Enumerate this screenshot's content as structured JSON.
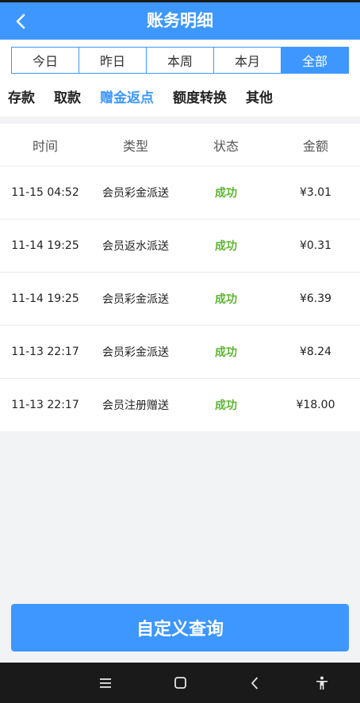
{
  "header": {
    "title": "账务明细",
    "back_icon": "chevron-left-icon"
  },
  "periods": [
    {
      "label": "今日",
      "active": false
    },
    {
      "label": "昨日",
      "active": false
    },
    {
      "label": "本周",
      "active": false
    },
    {
      "label": "本月",
      "active": false
    },
    {
      "label": "全部",
      "active": true
    }
  ],
  "categories": [
    {
      "label": "存款",
      "active": false
    },
    {
      "label": "取款",
      "active": false
    },
    {
      "label": "赠金返点",
      "active": true
    },
    {
      "label": "额度转换",
      "active": false
    },
    {
      "label": "其他",
      "active": false
    }
  ],
  "table": {
    "headers": [
      "时间",
      "类型",
      "状态",
      "金额"
    ],
    "rows": [
      {
        "time": "11-15 04:52",
        "type": "会员彩金派送",
        "status": "成功",
        "amount": "¥3.01"
      },
      {
        "time": "11-14 19:25",
        "type": "会员返水派送",
        "status": "成功",
        "amount": "¥0.31"
      },
      {
        "time": "11-14 19:25",
        "type": "会员彩金派送",
        "status": "成功",
        "amount": "¥6.39"
      },
      {
        "time": "11-13 22:17",
        "type": "会员彩金派送",
        "status": "成功",
        "amount": "¥8.24"
      },
      {
        "time": "11-13 22:17",
        "type": "会员注册赠送",
        "status": "成功",
        "amount": "¥18.00"
      }
    ]
  },
  "query_button": {
    "label": "自定义查询"
  },
  "navbar": {
    "icons": [
      "menu-icon",
      "home-icon",
      "back-icon",
      "accessibility-icon"
    ]
  },
  "colors": {
    "accent": "#3d97ff",
    "success": "#5cb531",
    "navbar": "#1a1a1a"
  }
}
